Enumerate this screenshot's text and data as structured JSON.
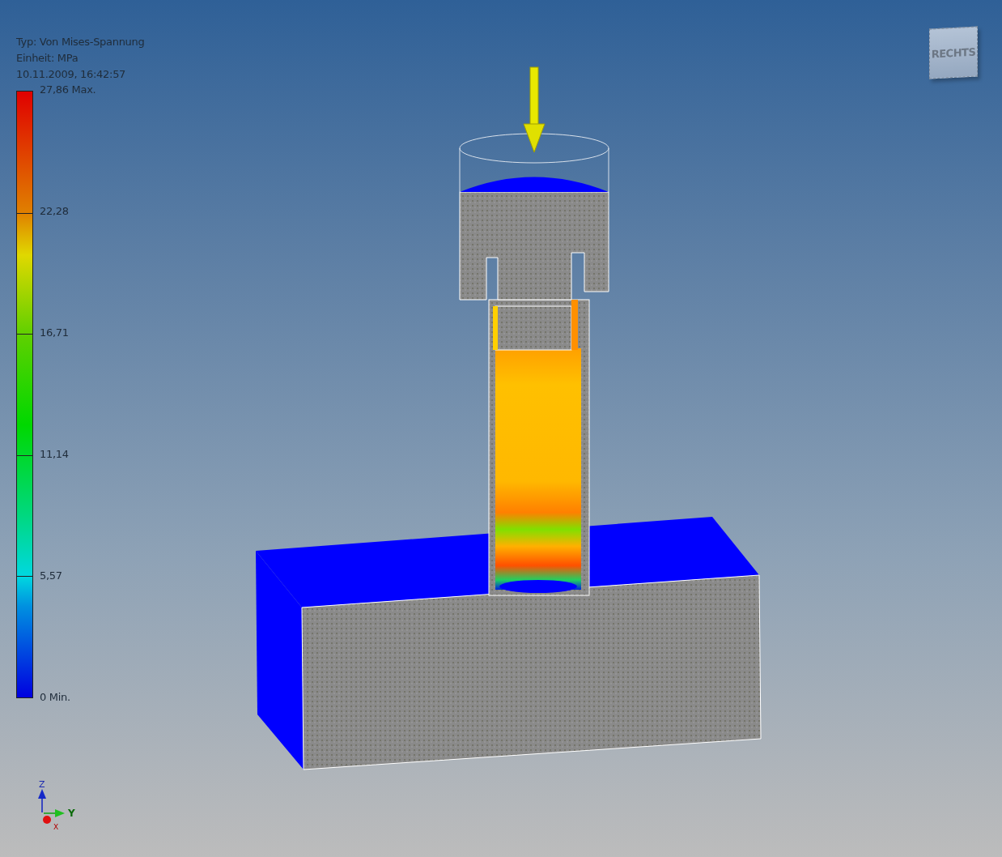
{
  "legend": {
    "type": "Typ: Von Mises-Spannung",
    "unit": "Einheit: MPa",
    "timestamp": "10.11.2009, 16:42:57",
    "labels": [
      "27,86 Max.",
      "22,28",
      "16,71",
      "11,14",
      "5,57",
      "0 Min."
    ]
  },
  "view_cube": {
    "label": "RECHTS"
  },
  "axis_triad": {
    "z": "Z",
    "y": "Y",
    "x": "X"
  }
}
